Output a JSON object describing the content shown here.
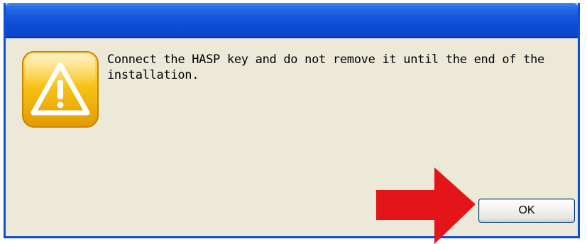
{
  "dialog": {
    "message_lines": [
      "Connect the HASP key and do not remove it until the end of the",
      "installation."
    ],
    "ok_label": "OK",
    "icon": "warning-icon"
  },
  "annotation": {
    "icon": "arrow-right-icon",
    "color": "#e3151b"
  },
  "colors": {
    "title_bar": "#0b4ad3",
    "dialog_background": "#ece9d8",
    "warning_yellow": "#f2b705"
  }
}
